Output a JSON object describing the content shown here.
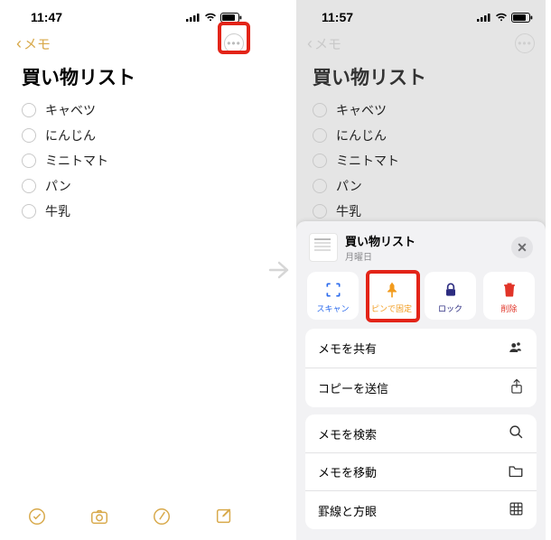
{
  "left": {
    "time": "11:47",
    "back_label": "メモ",
    "title": "買い物リスト",
    "items": [
      "キャベツ",
      "にんじん",
      "ミニトマト",
      "パン",
      "牛乳"
    ]
  },
  "right": {
    "time": "11:57",
    "back_label": "メモ",
    "title": "買い物リスト",
    "items": [
      "キャベツ",
      "にんじん",
      "ミニトマト",
      "パン",
      "牛乳"
    ]
  },
  "sheet": {
    "title": "買い物リスト",
    "subtitle": "月曜日",
    "actions": {
      "scan": "スキャン",
      "pin": "ピンで固定",
      "lock": "ロック",
      "delete": "削除"
    },
    "menu1": {
      "share": "メモを共有",
      "sendcopy": "コピーを送信"
    },
    "menu2": {
      "search": "メモを検索",
      "move": "メモを移動",
      "lines": "罫線と方眼"
    }
  }
}
